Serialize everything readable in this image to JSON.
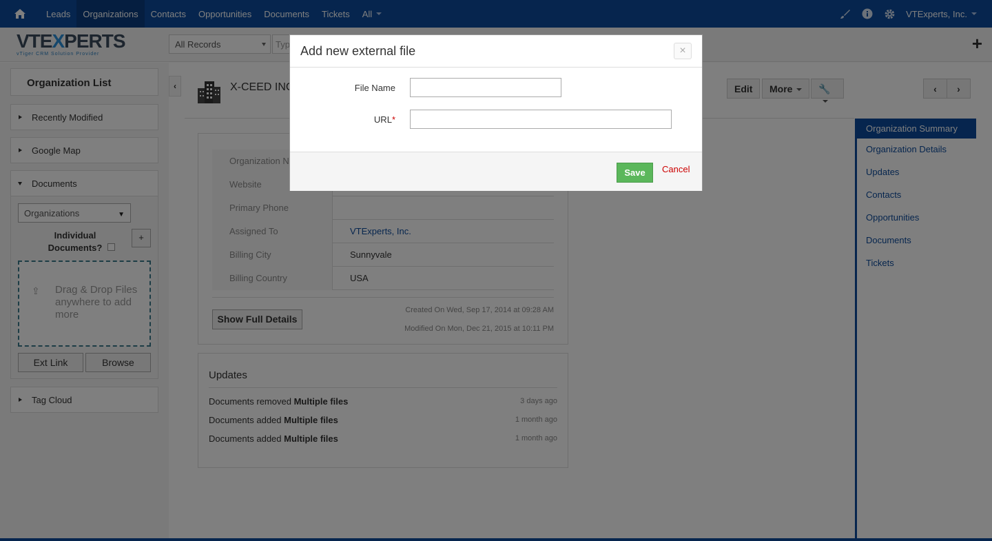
{
  "topnav": {
    "items": [
      "Leads",
      "Organizations",
      "Contacts",
      "Opportunities",
      "Documents",
      "Tickets",
      "All"
    ],
    "active": "Organizations",
    "user": "VTExperts, Inc."
  },
  "logo": {
    "main_pre": "VTE",
    "main_x": "X",
    "main_post": "PERTS",
    "tagline": "vTiger CRM Solution Provider"
  },
  "subheader": {
    "records_select": "All Records",
    "search_placeholder": "Typ"
  },
  "sidebar": {
    "title": "Organization List",
    "panels": [
      "Recently Modified",
      "Google Map",
      "Documents",
      "Tag Cloud"
    ],
    "documents": {
      "module_select": "Organizations",
      "individual_label": "Individual Documents?",
      "add_label": "+",
      "drop_text": "Drag & Drop Files anywhere to add more",
      "ext_link": "Ext Link",
      "browse": "Browse"
    }
  },
  "record": {
    "name": "X-CEED INC",
    "actions": {
      "edit": "Edit",
      "more": "More"
    },
    "fields": [
      {
        "label": "Organization Name",
        "value": ""
      },
      {
        "label": "Website",
        "value": ""
      },
      {
        "label": "Primary Phone",
        "value": ""
      },
      {
        "label": "Assigned To",
        "value": "VTExperts, Inc."
      },
      {
        "label": "Billing City",
        "value": "Sunnyvale"
      },
      {
        "label": "Billing Country",
        "value": "USA"
      }
    ],
    "show_full": "Show Full Details",
    "created": "Created On Wed, Sep 17, 2014 at 09:28 AM",
    "modified": "Modified On Mon, Dec 21, 2015 at 10:11 PM"
  },
  "updates": {
    "title": "Updates",
    "items": [
      {
        "action": "Documents removed",
        "object": "Multiple files",
        "time": "3 days ago"
      },
      {
        "action": "Documents added",
        "object": "Multiple files",
        "time": "1 month ago"
      },
      {
        "action": "Documents added",
        "object": "Multiple files",
        "time": "1 month ago"
      }
    ]
  },
  "rightnav": {
    "items": [
      "Organization Summary",
      "Organization Details",
      "Updates",
      "Contacts",
      "Opportunities",
      "Documents",
      "Tickets"
    ],
    "active": "Organization Summary"
  },
  "modal": {
    "title": "Add new external file",
    "close": "×",
    "file_name_label": "File Name",
    "file_name_value": "",
    "url_label": "URL",
    "url_required": "*",
    "url_value": "",
    "save": "Save",
    "cancel": "Cancel"
  },
  "colors": {
    "nav": "#0c4b9c",
    "save": "#5bb75b",
    "cancel": "#cc0000"
  }
}
